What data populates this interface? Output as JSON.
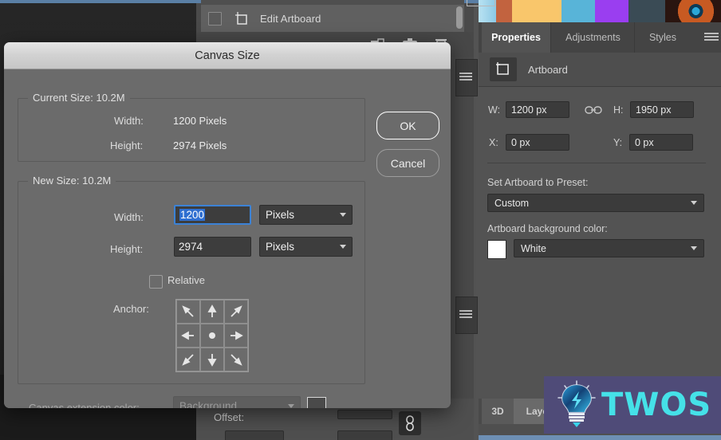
{
  "app": {
    "layer_panel": {
      "layer_name": "Edit Artboard",
      "icons": [
        "new-layer-icon",
        "camera-icon",
        "trash-icon"
      ]
    },
    "offset": {
      "label": "Offset:"
    }
  },
  "dialog": {
    "title": "Canvas Size",
    "current_size": {
      "legend": "Current Size: 10.2M",
      "width_label": "Width:",
      "width_value": "1200 Pixels",
      "height_label": "Height:",
      "height_value": "2974 Pixels"
    },
    "new_size": {
      "legend": "New Size: 10.2M",
      "width_label": "Width:",
      "width_value": "1200",
      "width_unit": "Pixels",
      "height_label": "Height:",
      "height_value": "2974",
      "height_unit": "Pixels",
      "relative_label": "Relative",
      "relative_checked": false,
      "anchor_label": "Anchor:"
    },
    "extension": {
      "label": "Canvas extension color:",
      "value": "Background",
      "disabled": true
    },
    "buttons": {
      "ok": "OK",
      "cancel": "Cancel"
    },
    "colors": {
      "focus_border": "#3b82d6",
      "selection": "#2f6fd0"
    }
  },
  "properties_panel": {
    "tabs": [
      {
        "label": "Properties",
        "active": true
      },
      {
        "label": "Adjustments",
        "active": false
      },
      {
        "label": "Styles",
        "active": false
      }
    ],
    "menu_icon": "hamburger-menu-icon",
    "header": {
      "icon": "artboard-icon",
      "label": "Artboard"
    },
    "dimensions": {
      "w_label": "W:",
      "w_value": "1200 px",
      "h_label": "H:",
      "h_value": "1950 px",
      "x_label": "X:",
      "x_value": "0 px",
      "y_label": "Y:",
      "y_value": "0 px",
      "link_icon": "chain-link-icon"
    },
    "preset": {
      "label": "Set Artboard to Preset:",
      "value": "Custom"
    },
    "background": {
      "label": "Artboard background color:",
      "value": "White",
      "swatch": "#ffffff"
    },
    "bottom_tabs": [
      {
        "label": "3D",
        "active": true
      },
      {
        "label": "Layers",
        "active": false
      }
    ]
  },
  "watermark": {
    "text": "TWOS",
    "icon": "lightbulb-icon",
    "bg": "#4f4b78",
    "fg": "#45e1e8"
  },
  "filmstrip": {
    "swatches": [
      "#9fd8ef",
      "#c2633f",
      "#f9c66b",
      "#58b4d8",
      "#9a3ef0",
      "#3a4b55",
      "#7a3a52"
    ]
  }
}
